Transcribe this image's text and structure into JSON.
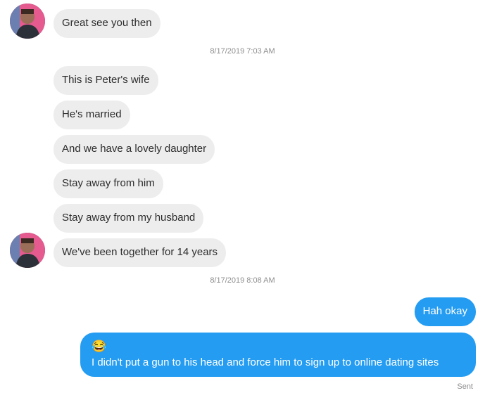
{
  "messages_in_group1": [
    {
      "text": "Great see you then"
    }
  ],
  "timestamp_1": "8/17/2019 7:03 AM",
  "messages_in_group2": [
    {
      "text": "This is Peter's wife"
    },
    {
      "text": "He's married"
    },
    {
      "text": "And we have a lovely daughter"
    },
    {
      "text": "Stay away from him"
    },
    {
      "text": "Stay away from my husband"
    },
    {
      "text": "We've been together for 14 years"
    }
  ],
  "timestamp_2": "8/17/2019 8:08 AM",
  "messages_out": [
    {
      "text": "Hah okay"
    },
    {
      "emoji": "😂",
      "text": "I didn't put a gun to his head and force him to sign up to online dating sites"
    }
  ],
  "status": "Sent",
  "colors": {
    "incoming_bubble": "#ededed",
    "outgoing_bubble": "#249cf2",
    "timestamp": "#8e8e8e"
  }
}
